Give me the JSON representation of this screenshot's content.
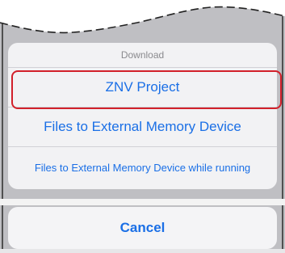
{
  "action_sheet": {
    "title": "Download",
    "items": [
      {
        "label": "ZNV Project"
      },
      {
        "label": "Files to External Memory Device"
      },
      {
        "label": "Files to External Memory Device while running"
      }
    ],
    "cancel_label": "Cancel"
  },
  "colors": {
    "accent": "#1a6fe6",
    "highlight": "#d2202a",
    "sheet_bg": "#f2f2f4",
    "muted_text": "#8a8a8e"
  }
}
